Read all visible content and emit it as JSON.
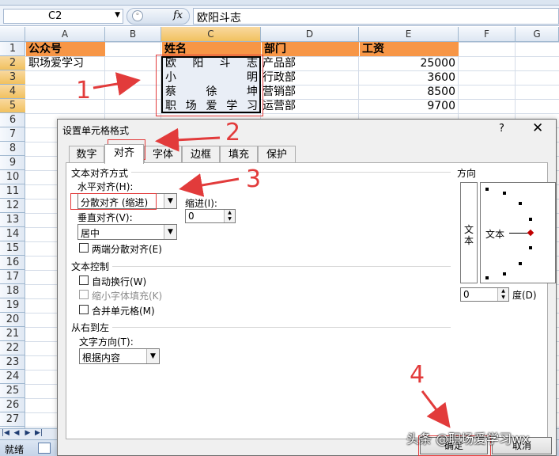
{
  "formula_bar": {
    "name_box": "C2",
    "fx": "fx",
    "content": "欧阳斗志"
  },
  "columns": [
    "A",
    "B",
    "C",
    "D",
    "E",
    "F",
    "G"
  ],
  "rows": [
    "1",
    "2",
    "3",
    "4",
    "5",
    "6",
    "7",
    "8",
    "9",
    "10",
    "11",
    "12",
    "13",
    "14",
    "15",
    "16",
    "17",
    "18",
    "19",
    "20",
    "21",
    "22",
    "23",
    "24",
    "25",
    "26",
    "27"
  ],
  "sheet": {
    "headers": {
      "a": "公众号",
      "c": "姓名",
      "d": "部门",
      "e": "工资"
    },
    "a2": "职场爱学习",
    "records": [
      {
        "name_chars": [
          "欧",
          "阳",
          "斗",
          "志"
        ],
        "dept": "产品部",
        "salary": "25000"
      },
      {
        "name_chars": [
          "小",
          "明"
        ],
        "dept": "行政部",
        "salary": "3600"
      },
      {
        "name_chars": [
          "蔡",
          "徐",
          "坤"
        ],
        "dept": "营销部",
        "salary": "8500"
      },
      {
        "name_chars": [
          "职",
          "场",
          "爱",
          "学",
          "习"
        ],
        "dept": "运营部",
        "salary": "9700"
      }
    ]
  },
  "status_bar": {
    "ready": "就绪"
  },
  "dialog": {
    "title": "设置单元格格式",
    "help": "?",
    "close": "✕",
    "tabs": [
      "数字",
      "对齐",
      "字体",
      "边框",
      "填充",
      "保护"
    ],
    "active_tab": "对齐",
    "alignment_section": "文本对齐方式",
    "horizontal_label": "水平对齐(H):",
    "horizontal_value": "分散对齐 (缩进)",
    "indent_label": "缩进(I):",
    "indent_value": "0",
    "vertical_label": "垂直对齐(V):",
    "vertical_value": "居中",
    "justify_distributed": "两端分散对齐(E)",
    "text_control_section": "文本控制",
    "wrap_text": "自动换行(W)",
    "shrink_to_fit": "缩小字体填充(K)",
    "merge_cells": "合并单元格(M)",
    "rtl_section": "从右到左",
    "direction_label": "文字方向(T):",
    "direction_value": "根据内容",
    "orientation_section": "方向",
    "orientation_vertical_text": "文本",
    "orientation_dial_text": "文本",
    "degrees_value": "0",
    "degrees_label": "度(D)",
    "ok": "确定",
    "cancel": "取消"
  },
  "annotations": {
    "n1": "1",
    "n2": "2",
    "n3": "3",
    "n4": "4"
  },
  "watermark": "头条 @职场爱学习wx",
  "colors": {
    "header_fill": "#f79646",
    "annotation_red": "#e23b3b",
    "selection_orange": "#f1c15f"
  }
}
